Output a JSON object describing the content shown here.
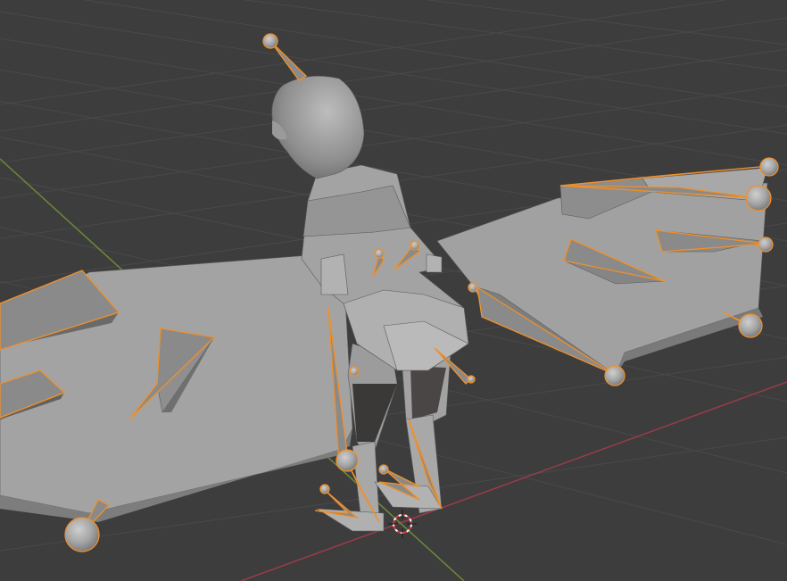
{
  "app": "Blender",
  "view": {
    "type": "3d-viewport",
    "shading": "solid",
    "mode": "pose",
    "selection": "armature-bones-selected",
    "grid": true
  },
  "colors": {
    "background": "#3d3d3d",
    "grid_line": "#4a4a4a",
    "x_axis": "#9a3c48",
    "y_axis": "#6a8a3a",
    "mesh_light": "#a8a8a8",
    "mesh_dark": "#6f6f6f",
    "bone_outline": "#f0902a"
  },
  "icons": {
    "cursor": "3d-cursor-icon"
  },
  "objects": {
    "mesh": "bird-character-mesh",
    "armature": "bird-armature"
  }
}
